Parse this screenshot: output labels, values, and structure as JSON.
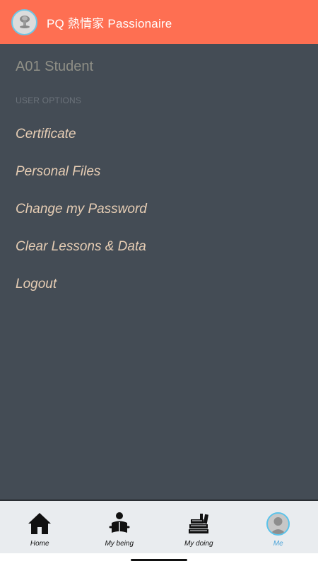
{
  "header": {
    "title": "PQ 熱情家 Passionaire",
    "logo_icon": "mushroom-cloud-logo-icon"
  },
  "drawer": {
    "user_name": "A01 Student",
    "section_label": "USER OPTIONS",
    "items": [
      {
        "label": "Certificate"
      },
      {
        "label": "Personal Files"
      },
      {
        "label": "Change my Password"
      },
      {
        "label": "Clear Lessons & Data"
      },
      {
        "label": "Logout"
      }
    ]
  },
  "bottom_nav": {
    "items": [
      {
        "label": "Home",
        "icon": "house-icon",
        "active": false
      },
      {
        "label": "My being",
        "icon": "person-reading-icon",
        "active": false
      },
      {
        "label": "My doing",
        "icon": "books-stack-icon",
        "active": false
      },
      {
        "label": "Me",
        "icon": "avatar-icon",
        "active": true
      }
    ]
  },
  "colors": {
    "header_bg": "#fe6f52",
    "content_bg": "#444c55",
    "menu_text": "#e6cdb4",
    "active_nav": "#4aa3d8"
  }
}
